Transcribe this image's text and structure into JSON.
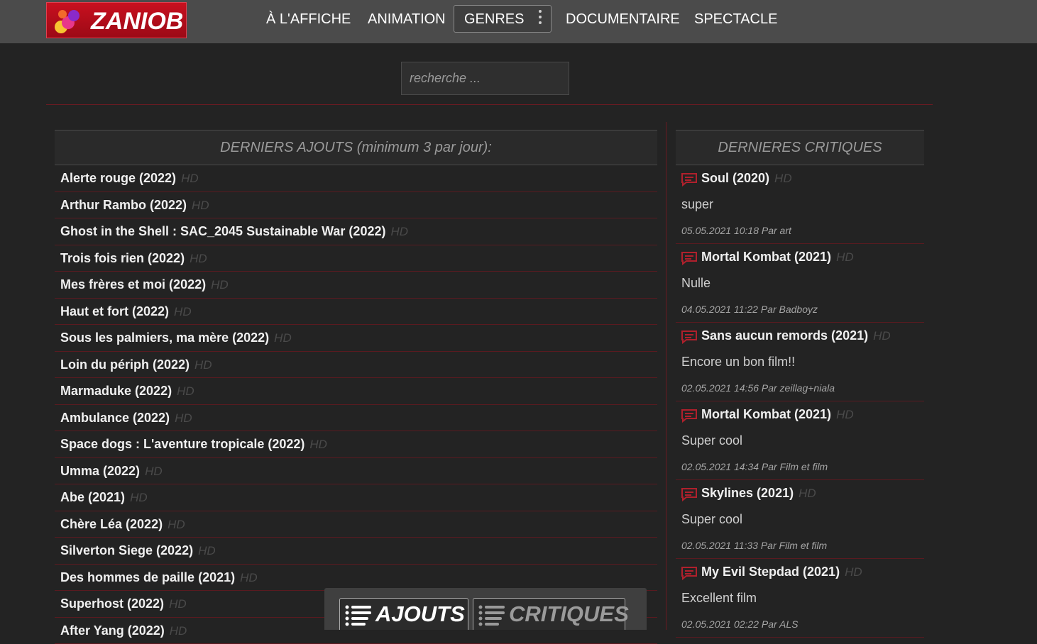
{
  "header": {
    "logo_text": "ZANIOB",
    "nav": [
      "À L'AFFICHE",
      "ANIMATION",
      "GENRES",
      "DOCUMENTAIRE",
      "SPECTACLE"
    ]
  },
  "search": {
    "placeholder": "recherche ..."
  },
  "latest": {
    "title": "DERNIERS AJOUTS (minimum 3 par jour):",
    "items": [
      {
        "title": "Alerte rouge (2022)",
        "badge": "HD"
      },
      {
        "title": "Arthur Rambo (2022)",
        "badge": "HD"
      },
      {
        "title": "Ghost in the Shell : SAC_2045 Sustainable War (2022)",
        "badge": "HD"
      },
      {
        "title": "Trois fois rien (2022)",
        "badge": "HD"
      },
      {
        "title": "Mes frères et moi (2022)",
        "badge": "HD"
      },
      {
        "title": "Haut et fort (2022)",
        "badge": "HD"
      },
      {
        "title": "Sous les palmiers, ma mère (2022)",
        "badge": "HD"
      },
      {
        "title": "Loin du périph (2022)",
        "badge": "HD"
      },
      {
        "title": "Marmaduke (2022)",
        "badge": "HD"
      },
      {
        "title": "Ambulance (2022)",
        "badge": "HD"
      },
      {
        "title": "Space dogs : L'aventure tropicale (2022)",
        "badge": "HD"
      },
      {
        "title": "Umma (2022)",
        "badge": "HD"
      },
      {
        "title": "Abe (2021)",
        "badge": "HD"
      },
      {
        "title": "Chère Léa (2022)",
        "badge": "HD"
      },
      {
        "title": "Silverton Siege (2022)",
        "badge": "HD"
      },
      {
        "title": "Des hommes de paille (2021)",
        "badge": "HD"
      },
      {
        "title": "Superhost (2022)",
        "badge": "HD"
      },
      {
        "title": "After Yang (2022)",
        "badge": "HD"
      }
    ]
  },
  "reviews": {
    "title": "DERNIERES CRITIQUES",
    "items": [
      {
        "title": "Soul (2020)",
        "badge": "HD",
        "comment": "super",
        "meta": "05.05.2021 10:18 Par art"
      },
      {
        "title": "Mortal Kombat (2021)",
        "badge": "HD",
        "comment": "Nulle",
        "meta": "04.05.2021 11:22 Par Badboyz"
      },
      {
        "title": "Sans aucun remords (2021)",
        "badge": "HD",
        "comment": "Encore un bon film!!",
        "meta": "02.05.2021 14:56 Par zeillag+niala"
      },
      {
        "title": "Mortal Kombat (2021)",
        "badge": "HD",
        "comment": "Super cool",
        "meta": "02.05.2021 14:34 Par Film et film"
      },
      {
        "title": "Skylines (2021)",
        "badge": "HD",
        "comment": "Super cool",
        "meta": "02.05.2021 11:33 Par Film et film"
      },
      {
        "title": "My Evil Stepdad (2021)",
        "badge": "HD",
        "comment": "Excellent film",
        "meta": "02.05.2021 02:22 Par ALS"
      }
    ]
  },
  "bottom_tabs": {
    "ajouts": "AJOUTS",
    "critiques": "CRITIQUES"
  },
  "colors": {
    "accent": "#c8101f",
    "divider": "#5a1a20",
    "background": "#232323"
  }
}
